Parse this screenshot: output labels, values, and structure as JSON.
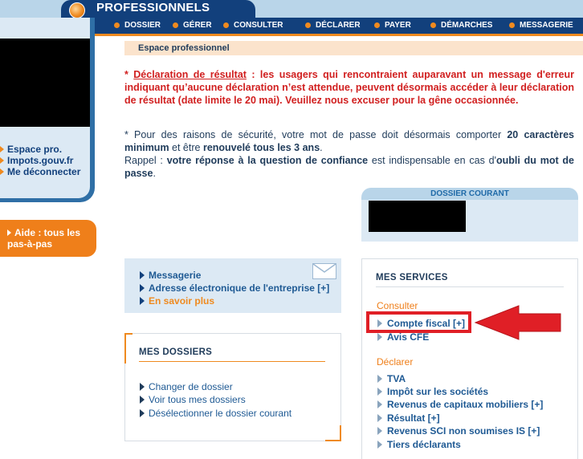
{
  "header": {
    "title": "PROFESSIONNELS",
    "nav": [
      "DOSSIER",
      "GÉRER",
      "CONSULTER",
      "DÉCLARER",
      "PAYER",
      "DÉMARCHES",
      "MESSAGERIE"
    ]
  },
  "sidebar": {
    "links": [
      "Espace pro.",
      "Impots.gouv.fr",
      "Me déconnecter"
    ],
    "help": "Aide : tous les pas-à-pas"
  },
  "main": {
    "section_label": "Espace professionnel",
    "notice_red": {
      "star": "* ",
      "title": "Déclaration de résultat",
      "text": " : les usagers qui rencontraient auparavant un message d'erreur indiquant qu’aucune déclaration n’est attendue, peuvent désormais accéder à leur déclaration de résultat (date limite le 20 mai). Veuillez nous excuser pour la gêne occasionnée."
    },
    "notice_security": {
      "p1_a": "* Pour des raisons de sécurité, votre mot de passe doit désormais comporter ",
      "p1_b": "20 caractères minimum",
      "p1_c": " et être ",
      "p1_d": "renouvelé tous les 3 ans",
      "p1_e": ".",
      "p2_a": "Rappel : ",
      "p2_b": "votre réponse à la question de confiance",
      "p2_c": " est indispensable en cas d'",
      "p2_d": "oubli du mot de passe",
      "p2_e": "."
    }
  },
  "dossier_courant": {
    "title": "DOSSIER COURANT"
  },
  "messagerie_box": {
    "links": [
      "Messagerie",
      "Adresse électronique de l'entreprise [+]"
    ],
    "more": "En savoir plus"
  },
  "mes_dossiers": {
    "title": "MES DOSSIERS",
    "links": [
      "Changer de dossier",
      "Voir tous mes dossiers",
      "Désélectionner le dossier courant"
    ]
  },
  "mes_services": {
    "title": "MES SERVICES",
    "consulter_label": "Consulter",
    "consulter": [
      "Compte fiscal [+]",
      "Avis CFE"
    ],
    "declarer_label": "Déclarer",
    "declarer": [
      "TVA",
      "Impôt sur les sociétés",
      "Revenus de capitaux mobiliers [+]",
      "Résultat [+]",
      "Revenus SCI non soumises IS [+]",
      "Tiers déclarants"
    ]
  },
  "colors": {
    "navy": "#12407c",
    "orange": "#ef8a1f",
    "light_blue": "#dce9f4",
    "highlight_red": "#e01f26"
  }
}
